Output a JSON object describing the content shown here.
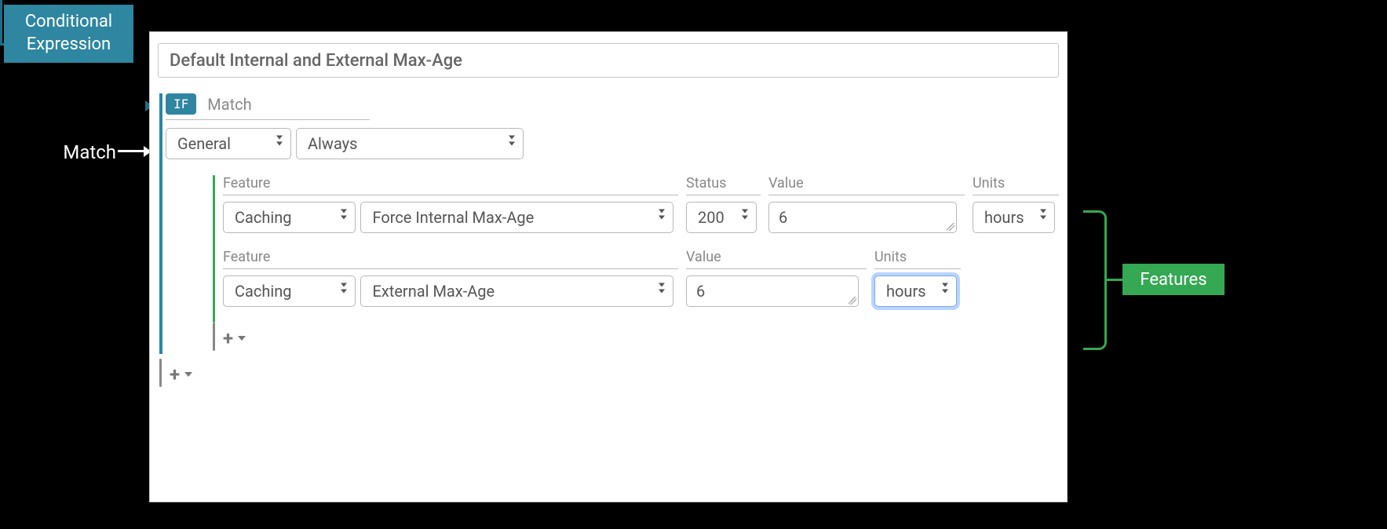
{
  "callouts": {
    "conditional1": "Conditional",
    "conditional2": "Expression",
    "match": "Match",
    "features": "Features"
  },
  "title": "Default Internal and External Max-Age",
  "if_badge": "IF",
  "if_label": "Match",
  "match_row": {
    "category": "General",
    "condition": "Always"
  },
  "labels": {
    "feature": "Feature",
    "status": "Status",
    "value": "Value",
    "units": "Units"
  },
  "features": [
    {
      "category": "Caching",
      "name": "Force Internal Max-Age",
      "status": "200",
      "value": "6",
      "units": "hours",
      "has_status": true,
      "units_focused": false
    },
    {
      "category": "Caching",
      "name": "External Max-Age",
      "status": null,
      "value": "6",
      "units": "hours",
      "has_status": false,
      "units_focused": true
    }
  ],
  "add_icon": "+",
  "colors": {
    "teal": "#2e86a1",
    "green": "#34a853"
  }
}
